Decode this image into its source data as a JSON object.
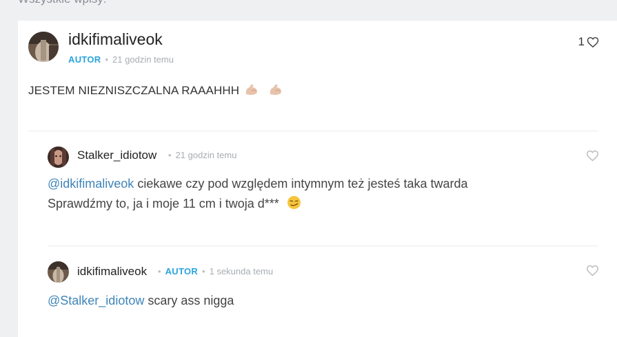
{
  "section": {
    "title": "Wszystkie wpisy:"
  },
  "post": {
    "author": "idkifimaliveok",
    "badge": "AUTOR",
    "time": "21 godzin temu",
    "likes": "1",
    "text": "JESTEM NIEZNISZCZALNA RAAAHHH",
    "emojis": [
      "flexed-biceps",
      "flexed-biceps"
    ]
  },
  "replies": [
    {
      "author": "Stalker_idiotow",
      "time": "21 godzin temu",
      "mention": "@idkifimaliveok",
      "line1": " ciekawe czy pod względem intymnym też jesteś taka twarda",
      "line2": "Sprawdźmy to, ja i moje 11 cm i twoja d***",
      "emoji": "smirking-face"
    },
    {
      "author": "idkifimaliveok",
      "badge": "AUTOR",
      "time": "1 sekunda temu",
      "mention": "@Stalker_idiotow",
      "line1": " scary ass nigga"
    }
  ],
  "colors": {
    "badge": "#2aa3dd",
    "mention": "#3e84b8",
    "meta": "#a8adb2",
    "background": "#eef0f2"
  }
}
